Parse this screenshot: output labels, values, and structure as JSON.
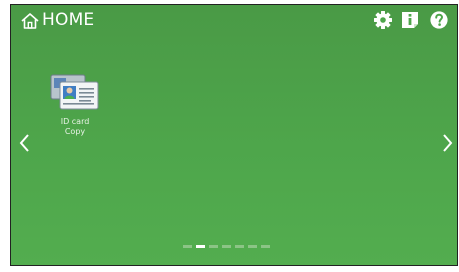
{
  "header": {
    "title": "HOME",
    "icons": [
      "home-icon",
      "gear-icon",
      "info-icon",
      "help-icon"
    ]
  },
  "apps": [
    {
      "label_line1": "ID card",
      "label_line2": "Copy",
      "icon": "id-card-icon"
    }
  ],
  "pager": {
    "total_pages": 7,
    "current_page": 2
  },
  "colors": {
    "background": "#4ea64b",
    "text": "#ffffff",
    "pager_inactive": "#8cc486",
    "pager_active": "#ffffff"
  }
}
